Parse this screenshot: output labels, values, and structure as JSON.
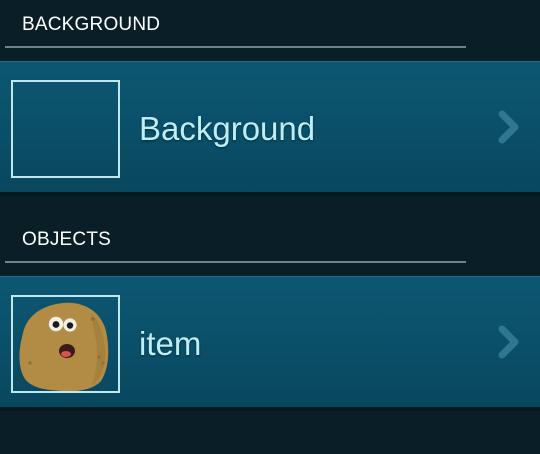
{
  "sections": [
    {
      "header": "BACKGROUND",
      "item": {
        "label": "Background",
        "thumbnail_icon": "empty-background-thumbnail",
        "chevron_icon": "chevron-right-icon"
      }
    },
    {
      "header": "OBJECTS",
      "item": {
        "label": "item",
        "thumbnail_icon": "potato-character-thumbnail",
        "chevron_icon": "chevron-right-icon"
      }
    }
  ],
  "colors": {
    "page_background": "#0a1e27",
    "header_text": "#ffffff",
    "header_underline": "#6f8389",
    "item_background": "#0a4e67",
    "item_label": "#bdeef6",
    "thumbnail_border": "#bfe7ee",
    "chevron": "#2f7690"
  }
}
